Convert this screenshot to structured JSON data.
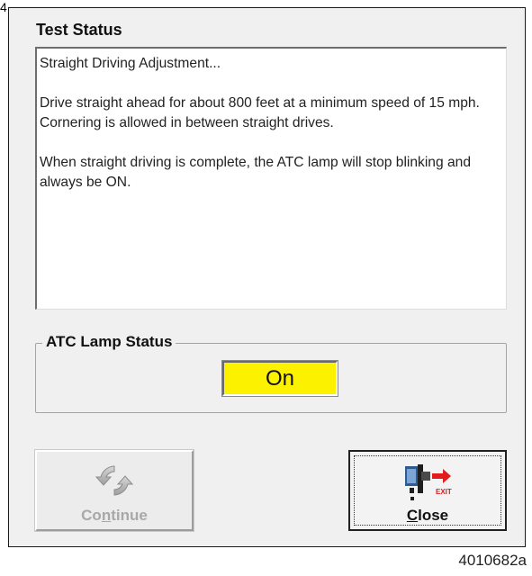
{
  "edge_mark": "4",
  "dialog": {
    "title": "Test Status",
    "status_text": {
      "paragraphs": [
        "Straight Driving Adjustment...",
        "Drive straight ahead for about 800 feet at a minimum speed of 15 mph.  Cornering is allowed in between straight drives.",
        "When straight driving is complete, the ATC lamp will stop blinking and always be ON."
      ]
    },
    "lamp_status": {
      "label": "ATC Lamp Status",
      "value": "On",
      "indicator_color": "#fcf200"
    },
    "buttons": {
      "continue": {
        "label_before": "Co",
        "label_mnemonic": "n",
        "label_after": "tinue",
        "enabled": false,
        "icon": "refresh-icon"
      },
      "close": {
        "label_before": "",
        "label_mnemonic": "C",
        "label_after": "lose",
        "enabled": true,
        "icon": "exit-icon",
        "icon_text": "EXIT"
      }
    }
  },
  "figure_id": "4010682a"
}
